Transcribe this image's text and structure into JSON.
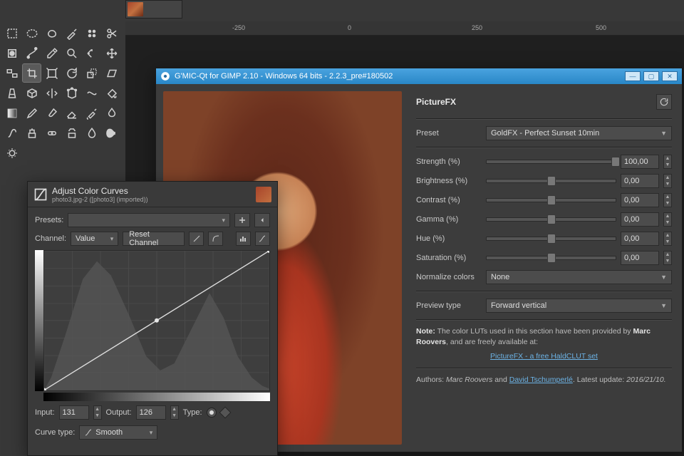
{
  "ruler_ticks": [
    "-250",
    "0",
    "250",
    "500"
  ],
  "gmic": {
    "title": "G'MIC-Qt for GIMP 2.10 - Windows 64 bits - 2.2.3_pre#180502",
    "panel_name": "PictureFX",
    "preset": {
      "label": "Preset",
      "value": "GoldFX - Perfect Sunset 10min"
    },
    "sliders": [
      {
        "label": "Strength (%)",
        "value": "100,00",
        "pos": 100
      },
      {
        "label": "Brightness (%)",
        "value": "0,00",
        "pos": 50
      },
      {
        "label": "Contrast (%)",
        "value": "0,00",
        "pos": 50
      },
      {
        "label": "Gamma (%)",
        "value": "0,00",
        "pos": 50
      },
      {
        "label": "Hue (%)",
        "value": "0,00",
        "pos": 50
      },
      {
        "label": "Saturation (%)",
        "value": "0,00",
        "pos": 50
      }
    ],
    "normalize": {
      "label": "Normalize colors",
      "value": "None"
    },
    "preview": {
      "label": "Preview type",
      "value": "Forward vertical"
    },
    "note_prefix": "Note:",
    "note_text": " The color LUTs used in this section have been provided by ",
    "note_author": "Marc Roovers",
    "note_suffix": ", and are freely available at:",
    "note_link": "PictureFX - a free HaldCLUT set",
    "authors_prefix": "Authors: ",
    "author1": "Marc Roovers",
    "and": " and ",
    "author2": "David Tschumperlé",
    "latest_prefix": ". Latest update: ",
    "latest_date": "2016/21/10."
  },
  "curves": {
    "title": "Adjust Color Curves",
    "subtitle": "photo3.jpg-2 ([photo3] (imported))",
    "presets_label": "Presets:",
    "presets_value": "",
    "channel_label": "Channel:",
    "channel_value": "Value",
    "reset_channel": "Reset Channel",
    "input_label": "Input:",
    "input_value": "131",
    "output_label": "Output:",
    "output_value": "126",
    "type_label": "Type:",
    "curve_type_label": "Curve type:",
    "curve_type_value": "Smooth"
  }
}
